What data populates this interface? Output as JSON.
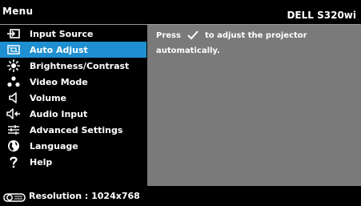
{
  "header": {
    "title": "Menu",
    "model": "DELL S320wi"
  },
  "menu": {
    "selected_index": 1,
    "items": [
      {
        "label": "Input Source",
        "icon": "input-source-icon"
      },
      {
        "label": "Auto Adjust",
        "icon": "auto-adjust-icon"
      },
      {
        "label": "Brightness/Contrast",
        "icon": "brightness-icon"
      },
      {
        "label": "Video Mode",
        "icon": "video-mode-icon"
      },
      {
        "label": "Volume",
        "icon": "volume-icon"
      },
      {
        "label": "Audio Input",
        "icon": "audio-input-icon"
      },
      {
        "label": "Advanced Settings",
        "icon": "advanced-settings-icon"
      },
      {
        "label": "Language",
        "icon": "language-icon"
      },
      {
        "label": "Help",
        "icon": "help-icon"
      }
    ]
  },
  "content": {
    "line1_before": "Press",
    "line1_after": "to adjust the projector",
    "line2": "automatically.",
    "checkmark_icon": "checkmark-icon"
  },
  "footer": {
    "resolution": "Resolution : 1024x768",
    "icon": "projector-icon"
  },
  "colors": {
    "selected": "#1e8fd0",
    "panel": "#7a7a7a",
    "background": "#000000"
  }
}
